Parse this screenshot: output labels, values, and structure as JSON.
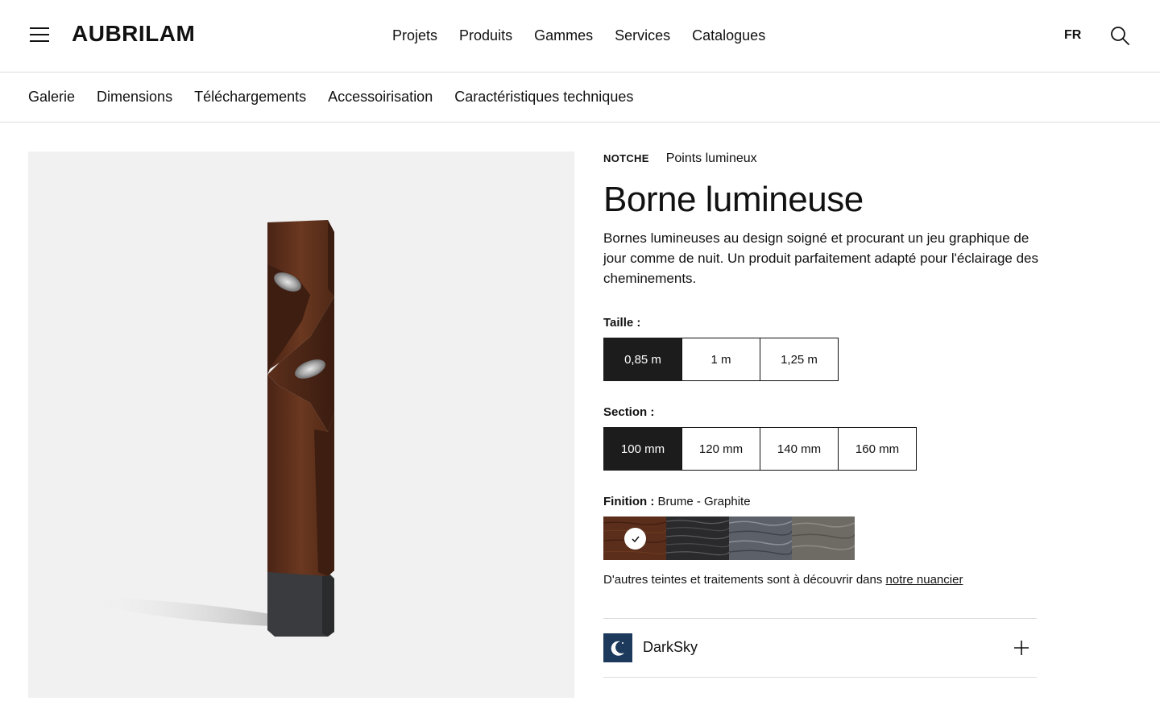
{
  "header": {
    "logo": "AUBRILAM",
    "nav": [
      "Projets",
      "Produits",
      "Gammes",
      "Services",
      "Catalogues"
    ],
    "lang": "FR",
    "icons": {
      "menu": "menu-icon",
      "search": "search-icon"
    }
  },
  "subnav": [
    "Galerie",
    "Dimensions",
    "Téléchargements",
    "Accessoirisation",
    "Caractéristiques techniques"
  ],
  "product": {
    "brand": "NOTCHE",
    "category": "Points lumineux",
    "title": "Borne lumineuse",
    "description": "Bornes lumineuses au design soigné et procurant un jeu graphique de jour comme de nuit. Un produit parfaitement adapté pour l'éclairage des cheminements."
  },
  "taille": {
    "label": "Taille :",
    "options": [
      "0,85 m",
      "1 m",
      "1,25 m"
    ],
    "selected": "0,85 m"
  },
  "section": {
    "label": "Section :",
    "options": [
      "100 mm",
      "120 mm",
      "140 mm",
      "160 mm"
    ],
    "selected": "100 mm"
  },
  "finition": {
    "label": "Finition",
    "separator": " : ",
    "value": "Brume - Graphite",
    "swatches": [
      {
        "name": "brown-wood",
        "color": "#5a2e1a",
        "selected": true
      },
      {
        "name": "black-wood",
        "color": "#2a2a2c",
        "selected": false
      },
      {
        "name": "grey-blue-wood",
        "color": "#5c6169",
        "selected": false
      },
      {
        "name": "grey-wood",
        "color": "#6e6a64",
        "selected": false
      }
    ],
    "more_text": "D'autres teintes et traitements sont à découvrir dans ",
    "more_link": "notre nuancier"
  },
  "darksky": {
    "label": "DarkSky",
    "icon": "moon-icon",
    "expand_icon": "plus-icon",
    "icon_bg": "#1d3a5c"
  },
  "colors": {
    "text": "#111111",
    "border": "#dcdcdc",
    "image_bg": "#f1f1f1",
    "selected_bg": "#1c1c1c"
  }
}
